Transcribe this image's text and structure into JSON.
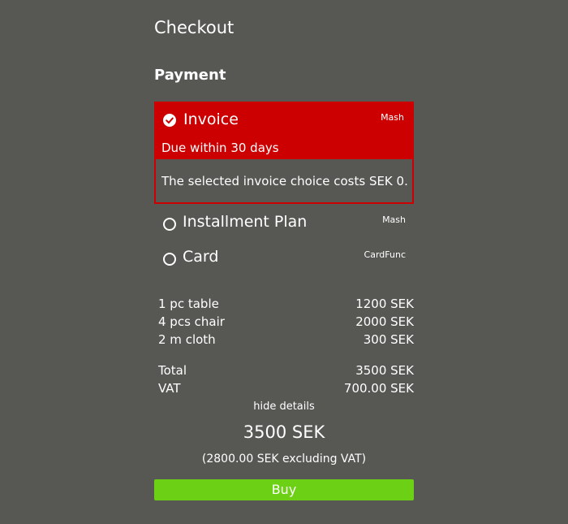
{
  "page_title": "Checkout",
  "section_title": "Payment",
  "payment_options": [
    {
      "name": "Invoice",
      "provider": "Mash",
      "selected": true,
      "subtitle": "Due within 30 days",
      "cost_note": "The selected invoice choice costs SEK 0."
    },
    {
      "name": "Installment Plan",
      "provider": "Mash",
      "selected": false
    },
    {
      "name": "Card",
      "provider": "CardFunc",
      "selected": false
    }
  ],
  "line_items": [
    {
      "label": "1 pc table",
      "amount": "1200 SEK"
    },
    {
      "label": "4 pcs chair",
      "amount": "2000 SEK"
    },
    {
      "label": "2 m cloth",
      "amount": "300 SEK"
    }
  ],
  "summary": [
    {
      "label": "Total",
      "amount": "3500 SEK"
    },
    {
      "label": "VAT",
      "amount": "700.00 SEK"
    }
  ],
  "toggle_details_label": "hide details",
  "grand_total": "3500 SEK",
  "excluding_vat": "(2800.00 SEK excluding VAT)",
  "buy_label": "Buy",
  "colors": {
    "background": "#575854",
    "selected_accent": "#cc0000",
    "buy_button": "#6cd115"
  }
}
